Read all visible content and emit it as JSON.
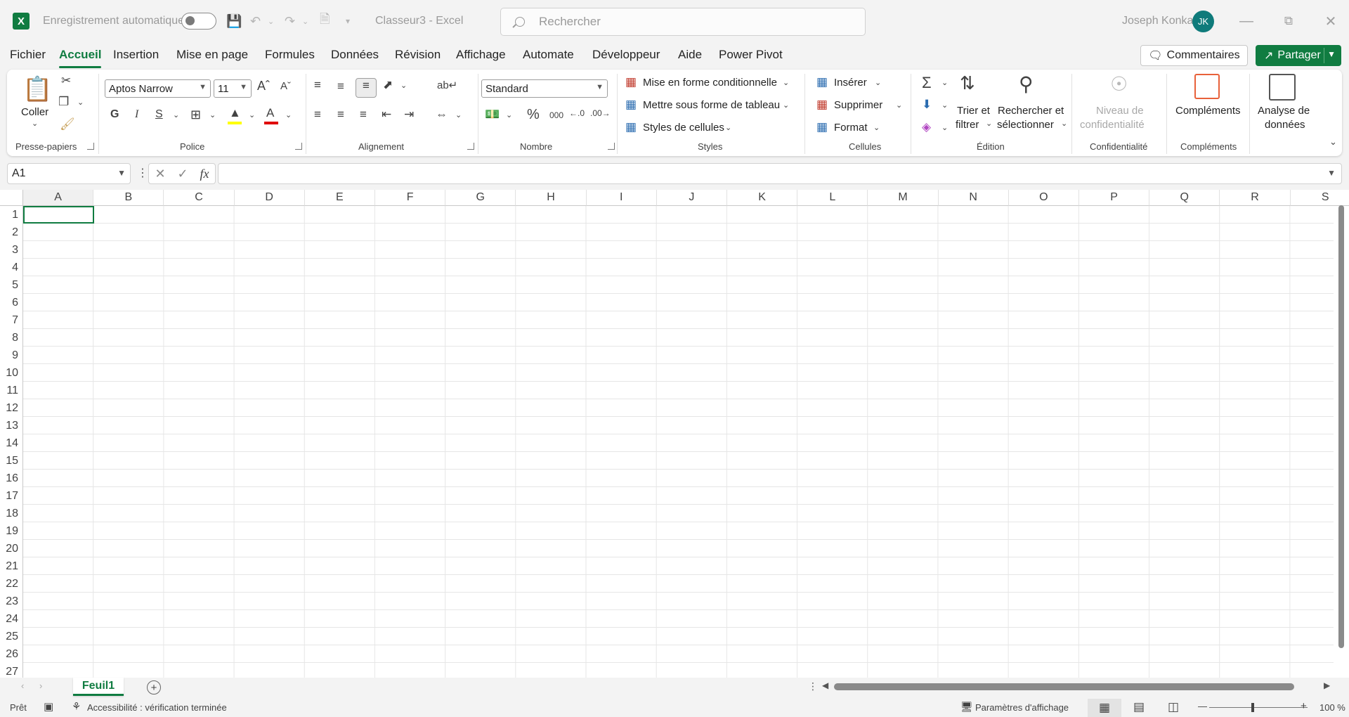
{
  "titlebar": {
    "app_icon": "X",
    "autosave_label": "Enregistrement automatique",
    "doc_title": "Classeur3  -  Excel",
    "search_placeholder": "Rechercher",
    "user_name": "Joseph Konka",
    "user_initials": "JK"
  },
  "tabs": [
    "Fichier",
    "Accueil",
    "Insertion",
    "Mise en page",
    "Formules",
    "Données",
    "Révision",
    "Affichage",
    "Automate",
    "Développeur",
    "Aide",
    "Power Pivot"
  ],
  "actions": {
    "comments": "Commentaires",
    "share": "Partager"
  },
  "ribbon": {
    "clipboard": {
      "label": "Presse-papiers",
      "paste": "Coller"
    },
    "font": {
      "label": "Police",
      "font_name": "Aptos Narrow",
      "font_size": "11",
      "bold": "G",
      "italic": "I",
      "underline": "S"
    },
    "alignment": {
      "label": "Alignement"
    },
    "number": {
      "label": "Nombre",
      "format": "Standard"
    },
    "styles": {
      "label": "Styles",
      "conditional": "Mise en forme conditionnelle",
      "as_table": "Mettre sous forme de tableau",
      "cell_styles": "Styles de cellules"
    },
    "cells": {
      "label": "Cellules",
      "insert": "Insérer",
      "delete": "Supprimer",
      "format": "Format"
    },
    "editing": {
      "label": "Édition",
      "sort": "Trier et\nfiltrer",
      "sort_1": "Trier et",
      "sort_2": "filtrer",
      "find_1": "Rechercher et",
      "find_2": "sélectionner"
    },
    "sensitivity": {
      "label": "Confidentialité",
      "level_1": "Niveau de",
      "level_2": "confidentialité"
    },
    "addins": {
      "label": "Compléments",
      "button": "Compléments"
    },
    "analysis": {
      "line1": "Analyse de",
      "line2": "données"
    }
  },
  "formula_bar": {
    "name_box": "A1",
    "fx": "fx",
    "content": ""
  },
  "grid": {
    "columns": [
      "A",
      "B",
      "C",
      "D",
      "E",
      "F",
      "G",
      "H",
      "I",
      "J",
      "K",
      "L",
      "M",
      "N",
      "O",
      "P",
      "Q",
      "R",
      "S"
    ],
    "rows": [
      "1",
      "2",
      "3",
      "4",
      "5",
      "6",
      "7",
      "8",
      "9",
      "10",
      "11",
      "12",
      "13",
      "14",
      "15",
      "16",
      "17",
      "18",
      "19",
      "20",
      "21",
      "22",
      "23",
      "24",
      "25",
      "26",
      "27"
    ]
  },
  "sheets": [
    "Feuil1"
  ],
  "status": {
    "ready": "Prêt",
    "accessibility": "Accessibilité : vérification terminée",
    "display_settings": "Paramètres d'affichage",
    "zoom": "100 %"
  },
  "colors": {
    "accent": "#107c41",
    "avatar": "#0f7b7b"
  }
}
